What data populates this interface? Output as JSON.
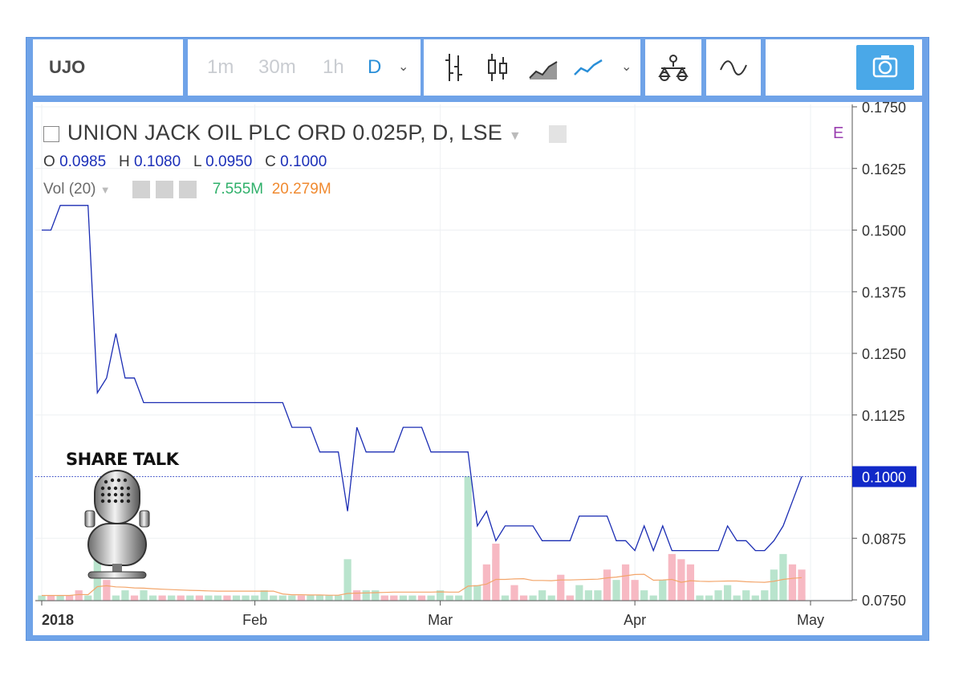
{
  "toolbar": {
    "symbol": "UJO",
    "timeframes": [
      "1m",
      "30m",
      "1h",
      "D"
    ],
    "active_timeframe": "D",
    "icons": [
      "bars-icon",
      "candles-icon",
      "area-icon",
      "line-icon",
      "chevron-down-icon",
      "compare-icon",
      "indicators-icon",
      "camera-icon"
    ]
  },
  "legend": {
    "title": "UNION JACK OIL PLC ORD 0.025P, D, LSE",
    "o_label": "O",
    "o": "0.0985",
    "h_label": "H",
    "h": "0.1080",
    "l_label": "L",
    "l": "0.0950",
    "c_label": "C",
    "c": "0.1000",
    "vol_label": "Vol (20)",
    "vol_value": "7.555M",
    "vol_ma": "20.279M",
    "e_flag": "E"
  },
  "watermark": {
    "text": "SHARE TALK"
  },
  "colors": {
    "price_line": "#1b2db3",
    "vol_up": "#b9e4cd",
    "vol_down": "#f7b9c3",
    "vol_ma": "#f3a56a",
    "last_price_bg": "#1129c8",
    "frame": "#6fa3e8"
  },
  "chart_data": {
    "type": "line",
    "title": "UNION JACK OIL PLC ORD 0.025P, D, LSE",
    "x_tick_labels": [
      "2018",
      "Feb",
      "Mar",
      "Apr",
      "May"
    ],
    "y_tick_labels": [
      "0.1750",
      "0.1625",
      "0.1500",
      "0.1375",
      "0.1250",
      "0.1125",
      "0.1000",
      "0.0875",
      "0.0750"
    ],
    "ylim": [
      0.075,
      0.175
    ],
    "last_price": "0.1000",
    "grid": true,
    "series": [
      {
        "x": [
          "2018-01-01",
          "2018-01-02",
          "2018-01-03",
          "2018-01-04",
          "2018-01-05",
          "2018-01-08",
          "2018-01-09",
          "2018-01-10",
          "2018-01-11",
          "2018-01-12",
          "2018-01-15",
          "2018-01-16",
          "2018-01-17",
          "2018-01-18",
          "2018-01-19",
          "2018-01-22",
          "2018-01-23",
          "2018-01-24",
          "2018-01-25",
          "2018-01-26",
          "2018-01-29",
          "2018-01-30",
          "2018-01-31",
          "2018-02-01",
          "2018-02-02",
          "2018-02-05",
          "2018-02-06",
          "2018-02-07",
          "2018-02-08",
          "2018-02-09",
          "2018-02-12",
          "2018-02-13",
          "2018-02-14",
          "2018-02-15",
          "2018-02-16",
          "2018-02-19",
          "2018-02-20",
          "2018-02-21",
          "2018-02-22",
          "2018-02-23",
          "2018-02-26",
          "2018-02-27",
          "2018-02-28",
          "2018-03-01",
          "2018-03-02",
          "2018-03-05",
          "2018-03-06",
          "2018-03-07",
          "2018-03-08",
          "2018-03-09",
          "2018-03-12",
          "2018-03-13",
          "2018-03-14",
          "2018-03-15",
          "2018-03-16",
          "2018-03-19",
          "2018-03-20",
          "2018-03-21",
          "2018-03-22",
          "2018-03-23",
          "2018-03-26",
          "2018-03-27",
          "2018-03-28",
          "2018-03-29",
          "2018-04-03",
          "2018-04-04",
          "2018-04-05",
          "2018-04-06",
          "2018-04-09",
          "2018-04-10",
          "2018-04-11",
          "2018-04-12",
          "2018-04-13",
          "2018-04-16",
          "2018-04-17",
          "2018-04-18",
          "2018-04-19",
          "2018-04-20",
          "2018-04-23",
          "2018-04-24",
          "2018-04-25",
          "2018-04-26",
          "2018-04-27"
        ],
        "values": [
          0.15,
          0.15,
          0.155,
          0.155,
          0.155,
          0.155,
          0.117,
          0.12,
          0.129,
          0.12,
          0.12,
          0.115,
          0.115,
          0.115,
          0.115,
          0.115,
          0.115,
          0.115,
          0.115,
          0.115,
          0.115,
          0.115,
          0.115,
          0.115,
          0.115,
          0.115,
          0.115,
          0.11,
          0.11,
          0.11,
          0.105,
          0.105,
          0.105,
          0.093,
          0.11,
          0.105,
          0.105,
          0.105,
          0.105,
          0.11,
          0.11,
          0.11,
          0.105,
          0.105,
          0.105,
          0.105,
          0.105,
          0.09,
          0.093,
          0.087,
          0.09,
          0.09,
          0.09,
          0.09,
          0.087,
          0.087,
          0.087,
          0.087,
          0.092,
          0.092,
          0.092,
          0.092,
          0.087,
          0.087,
          0.085,
          0.09,
          0.085,
          0.09,
          0.085,
          0.085,
          0.085,
          0.085,
          0.085,
          0.085,
          0.09,
          0.087,
          0.087,
          0.085,
          0.085,
          0.087,
          0.09,
          0.095,
          0.1
        ]
      }
    ],
    "volume": {
      "up": [
        1,
        0,
        1,
        0,
        0,
        1,
        12,
        0,
        1,
        2,
        0,
        2,
        1,
        0,
        1,
        0,
        1,
        0,
        1,
        1,
        0,
        1,
        1,
        1,
        2,
        1,
        1,
        1,
        0,
        1,
        1,
        1,
        1,
        8,
        0,
        2,
        2,
        1,
        1,
        1,
        1,
        0,
        1,
        2,
        1,
        1,
        24,
        3,
        0,
        8,
        1,
        0,
        1,
        1,
        2,
        1,
        0,
        1,
        3,
        2,
        2,
        0,
        4,
        0,
        2,
        2,
        1,
        4,
        0,
        0,
        0,
        1,
        1,
        2,
        3,
        1,
        2,
        1,
        2,
        6,
        9,
        3,
        1
      ],
      "down": [
        0,
        1,
        0,
        1,
        2,
        0,
        0,
        4,
        0,
        0,
        1,
        0,
        0,
        1,
        0,
        1,
        0,
        1,
        0,
        0,
        1,
        0,
        0,
        0,
        0,
        0,
        0,
        0,
        1,
        0,
        0,
        0,
        0,
        0,
        2,
        0,
        0,
        1,
        1,
        0,
        0,
        1,
        0,
        0,
        0,
        0,
        0,
        0,
        7,
        11,
        0,
        3,
        1,
        0,
        0,
        0,
        5,
        1,
        0,
        0,
        0,
        6,
        0,
        7,
        4,
        0,
        0,
        0,
        9,
        8,
        7,
        0,
        0,
        0,
        0,
        0,
        0,
        0,
        0,
        0,
        0,
        7,
        6
      ]
    }
  }
}
